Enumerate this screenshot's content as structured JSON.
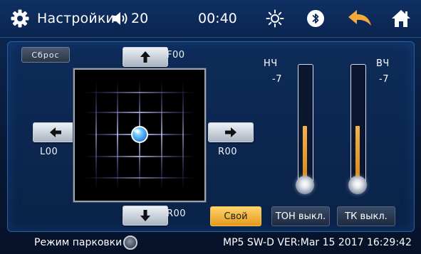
{
  "header": {
    "title": "Настройки",
    "volume": "20",
    "time": "00:40",
    "icons": [
      "gear-icon",
      "volume-icon",
      "brightness-icon",
      "bluetooth-icon",
      "back-icon",
      "home-icon"
    ]
  },
  "balance": {
    "reset_label": "Сброс",
    "front_label": "F00",
    "rear_label": "R00",
    "left_label": "L00",
    "right_label": "R00",
    "front_rear_position": 0,
    "left_right_position": 0,
    "arrows": [
      "arrow-up-icon",
      "arrow-down-icon",
      "arrow-left-icon",
      "arrow-right-icon"
    ]
  },
  "equalizer": {
    "bass": {
      "label": "НЧ",
      "value": "-7",
      "level_fraction": 0.5
    },
    "treble": {
      "label": "ВЧ",
      "value": "-7",
      "level_fraction": 0.5
    },
    "preset_label": "Свой",
    "tone_label": "ТОН выкл.",
    "loudness_label": "ТК выкл."
  },
  "footer": {
    "parking_label": "Режим парковки",
    "version": "MP5 SW-D VER:Mar 15 2017 16:29:42"
  },
  "colors": {
    "accent_orange": "#e9a23b",
    "background_navy": "#0b2450",
    "panel_border": "#2a5ea6",
    "back_arrow": "#f2a93b"
  }
}
